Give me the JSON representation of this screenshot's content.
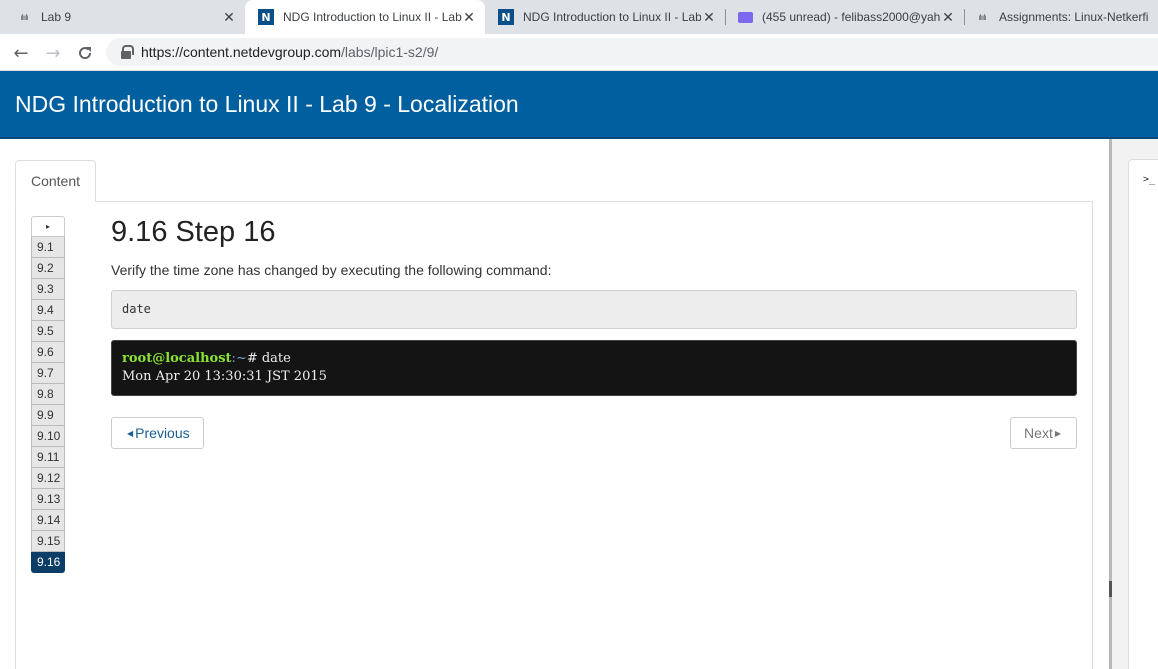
{
  "browser": {
    "tabs": [
      {
        "title": "Lab 9",
        "icon": "cisco-icon",
        "active": false
      },
      {
        "title": "NDG Introduction to Linux II - Lab",
        "icon": "ndg-n-icon",
        "active": true
      },
      {
        "title": "NDG Introduction to Linux II - Lab",
        "icon": "ndg-n-icon",
        "active": false
      },
      {
        "title": "(455 unread) - felibass2000@yah",
        "icon": "mail-icon",
        "active": false
      },
      {
        "title": "Assignments: Linux-Netkerfi",
        "icon": "cisco-icon",
        "active": false
      }
    ],
    "close_glyph": "✕",
    "url_host": "https://content.netdevgroup.com",
    "url_path": "/labs/lpic1-s2/9/"
  },
  "header": {
    "title": "NDG Introduction to Linux II - Lab 9 - Localization"
  },
  "panel_tab": "Content",
  "steps": {
    "toggle_glyph": "▸",
    "items": [
      "9.1",
      "9.2",
      "9.3",
      "9.4",
      "9.5",
      "9.6",
      "9.7",
      "9.8",
      "9.9",
      "9.10",
      "9.11",
      "9.12",
      "9.13",
      "9.14",
      "9.15",
      "9.16"
    ],
    "active": "9.16"
  },
  "main": {
    "heading": "9.16 Step 16",
    "instruction": "Verify the time zone has changed by executing the following command:",
    "command": "date",
    "terminal": {
      "user_host": "root@localhost",
      "path": ":~",
      "prompt_symbol": "#",
      "command": "date",
      "output": "Mon Apr 20 13:30:31 JST 2015"
    },
    "prev_label": "Previous",
    "next_label": "Next"
  },
  "right_panel": {
    "prompt_glyph": ">_"
  },
  "colors": {
    "header_bg": "#005f9e",
    "active_step": "#0b3d66",
    "terminal_bg": "#141414"
  }
}
